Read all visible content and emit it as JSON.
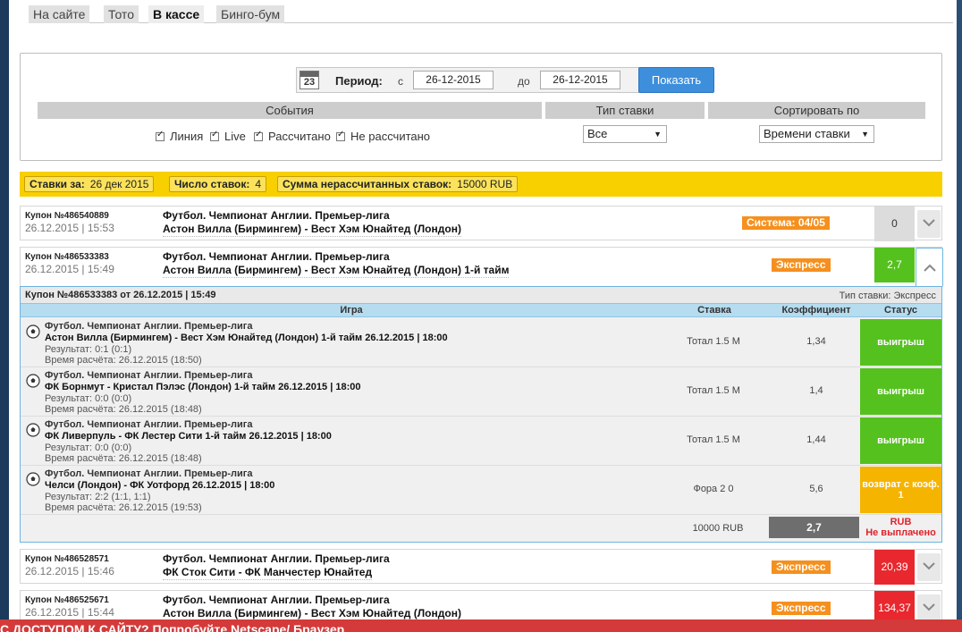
{
  "tabs": [
    {
      "label": "На сайте"
    },
    {
      "label": "Тото"
    },
    {
      "label": "В кассе"
    },
    {
      "label": "Бинго-бум"
    }
  ],
  "filter": {
    "calendar_day": "23",
    "period_label": "Период:",
    "from_label": "с",
    "from_date": "26-12-2015",
    "to_label": "до",
    "to_date": "26-12-2015",
    "show_button": "Показать",
    "events_header": "События",
    "bet_type_header": "Тип ставки",
    "sort_header": "Сортировать по",
    "checkboxes": [
      "Линия",
      "Live",
      "Рассчитано",
      "Не рассчитано"
    ],
    "bet_type_value": "Все",
    "sort_value": "Времени ставки"
  },
  "summary": {
    "bets_for_label": "Ставки за:",
    "bets_for_value": "26 дек 2015",
    "count_label": "Число ставок:",
    "count_value": "4",
    "unsettled_label": "Сумма нерассчитанных ставок:",
    "unsettled_value": "15000 RUB"
  },
  "coupons": [
    {
      "num": "Купон №486540889",
      "date": "26.12.2015 | 15:53",
      "league": "Футбол. Чемпионат Англии. Премьер-лига",
      "match": "Астон Вилла (Бирмингем) - Вест Хэм Юнайтед (Лондон)",
      "tag": "Система: 04/05",
      "value": "0"
    },
    {
      "num": "Купон №486533383",
      "date": "26.12.2015 | 15:49",
      "league": "Футбол. Чемпионат Англии. Премьер-лига",
      "match": "Астон Вилла (Бирмингем) - Вест Хэм Юнайтед (Лондон) 1-й тайм",
      "tag": "Экспресс",
      "value": "2,7"
    },
    {
      "num": "Купон №486528571",
      "date": "26.12.2015 | 15:46",
      "league": "Футбол. Чемпионат Англии. Премьер-лига",
      "match": "ФК Сток Сити - ФК Манчестер Юнайтед",
      "tag": "Экспресс",
      "value": "20,39"
    },
    {
      "num": "Купон №486525671",
      "date": "26.12.2015 | 15:44",
      "league": "Футбол. Чемпионат Англии. Премьер-лига",
      "match": "Астон Вилла (Бирмингем) - Вест Хэм Юнайтед (Лондон)",
      "tag": "Экспресс",
      "value": "134,37"
    }
  ],
  "detail": {
    "title": "Купон №486533383 от 26.12.2015 | 15:49",
    "bet_type": "Тип ставки: Экспресс",
    "columns": [
      "Игра",
      "Ставка",
      "Коэффициент",
      "Статус"
    ],
    "items": [
      {
        "league": "Футбол. Чемпионат Англии. Премьер-лига",
        "match": "Астон Вилла (Бирмингем) - Вест Хэм Юнайтед (Лондон) 1-й тайм 26.12.2015 | 18:00",
        "result": "Результат: 0:1 (0:1)",
        "calc": "Время расчёта: 26.12.2015 (18:50)",
        "bet": "Тотал 1.5 М",
        "coef": "1,34",
        "status": "выигрыш"
      },
      {
        "league": "Футбол. Чемпионат Англии. Премьер-лига",
        "match": "ФК Борнмут - Кристал Пэлэс (Лондон) 1-й тайм 26.12.2015 | 18:00",
        "result": "Результат: 0:0 (0:0)",
        "calc": "Время расчёта: 26.12.2015 (18:48)",
        "bet": "Тотал 1.5 М",
        "coef": "1,4",
        "status": "выигрыш"
      },
      {
        "league": "Футбол. Чемпионат Англии. Премьер-лига",
        "match": "ФК Ливерпуль - ФК Лестер Сити 1-й тайм 26.12.2015 | 18:00",
        "result": "Результат: 0:0 (0:0)",
        "calc": "Время расчёта: 26.12.2015 (18:48)",
        "bet": "Тотал 1.5 М",
        "coef": "1,44",
        "status": "выигрыш"
      },
      {
        "league": "Футбол. Чемпионат Англии. Премьер-лига",
        "match": "Челси (Лондон) - ФК Уотфорд 26.12.2015 | 18:00",
        "result": "Результат: 2:2 (1:1, 1:1)",
        "calc": "Время расчёта: 26.12.2015 (19:53)",
        "bet": "Фора 2 0",
        "coef": "5,6",
        "status": "возврат с коэф. 1"
      }
    ],
    "sum_amount": "10000 RUB",
    "sum_coef": "2,7",
    "sum_currency": "RUB",
    "sum_status": "Не выплачено"
  },
  "banner": "С ДОСТУПОМ К САЙТУ? Попробуйте Netscape/ Браузер"
}
